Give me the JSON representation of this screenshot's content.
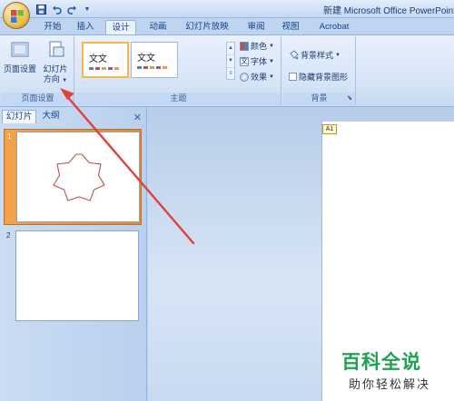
{
  "window": {
    "title": "新建 Microsoft Office PowerPoint"
  },
  "qat": {
    "icons": [
      "save-icon",
      "undo-icon",
      "redo-icon"
    ]
  },
  "tabs": [
    {
      "label": "开始"
    },
    {
      "label": "插入"
    },
    {
      "label": "设计",
      "active": true
    },
    {
      "label": "动画"
    },
    {
      "label": "幻灯片放映"
    },
    {
      "label": "审阅"
    },
    {
      "label": "视图"
    },
    {
      "label": "Acrobat"
    }
  ],
  "ribbon": {
    "page_setup": {
      "page_setup_label": "页面设置",
      "orientation_label_1": "幻灯片",
      "orientation_label_2": "方向",
      "group_label": "页面设置"
    },
    "themes": {
      "thumbs": [
        {
          "text": "文文"
        },
        {
          "text": "文文"
        }
      ],
      "colors_label": "颜色",
      "fonts_label": "字体",
      "effects_label": "效果",
      "group_label": "主题"
    },
    "background": {
      "styles_label": "背景样式",
      "hide_graphics_label": "隐藏背景图形",
      "group_label": "背景"
    }
  },
  "pane": {
    "tabs": [
      {
        "label": "幻灯片",
        "active": true
      },
      {
        "label": "大纲"
      }
    ],
    "slides": [
      {
        "number": "1",
        "selected": true,
        "content": "star"
      },
      {
        "number": "2",
        "selected": false,
        "content": "blank"
      }
    ]
  },
  "main": {
    "placeholder_tag": "A1"
  },
  "watermark": {
    "title": "百科全说",
    "subtitle": "助你轻松解决"
  },
  "colors": {
    "accent_arrow": "#e0413a",
    "selection_orange": "#f0a04a",
    "ribbon_blue": "#d5e4f7",
    "watermark_green": "#1da24e"
  }
}
